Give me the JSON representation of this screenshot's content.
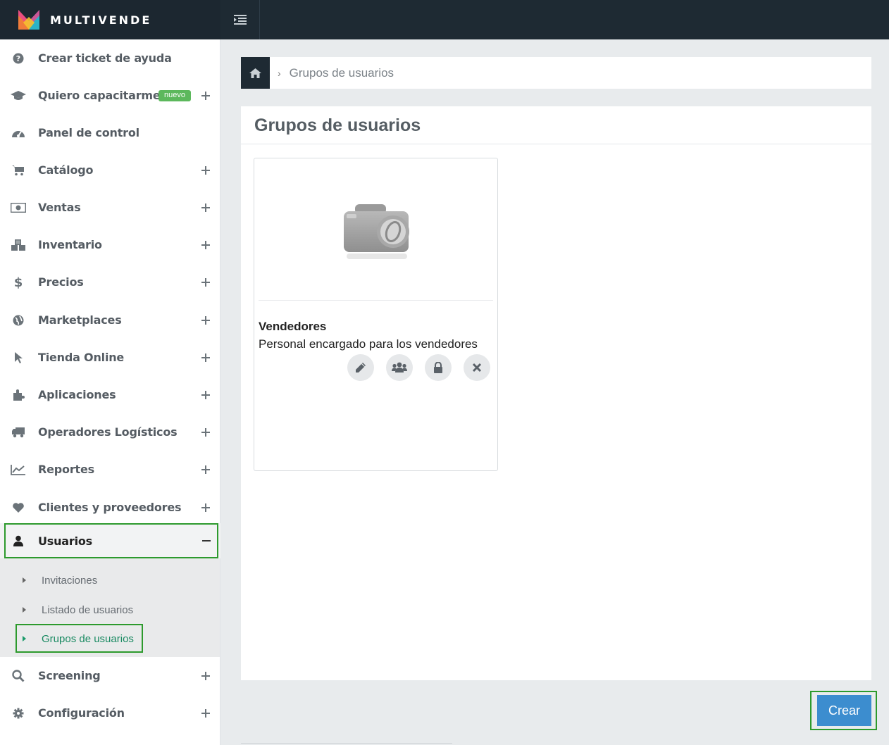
{
  "brand": {
    "name": "MULTIVENDE"
  },
  "breadcrumb": {
    "current": "Grupos de usuarios"
  },
  "sidebar": {
    "items": [
      {
        "label": "Crear ticket de ayuda",
        "icon": "question-circle-icon"
      },
      {
        "label": "Quiero capacitarme",
        "icon": "graduation-cap-icon",
        "badge": "nuevo"
      },
      {
        "label": "Panel de control",
        "icon": "dashboard-icon"
      },
      {
        "label": "Catálogo",
        "icon": "shopping-cart-icon"
      },
      {
        "label": "Ventas",
        "icon": "money-icon"
      },
      {
        "label": "Inventario",
        "icon": "cubes-icon"
      },
      {
        "label": "Precios",
        "icon": "dollar-icon"
      },
      {
        "label": "Marketplaces",
        "icon": "globe-icon"
      },
      {
        "label": "Tienda Online",
        "icon": "pointer-icon"
      },
      {
        "label": "Aplicaciones",
        "icon": "puzzle-icon"
      },
      {
        "label": "Operadores Logísticos",
        "icon": "truck-icon"
      },
      {
        "label": "Reportes",
        "icon": "line-chart-icon"
      },
      {
        "label": "Clientes y proveedores",
        "icon": "heart-icon"
      },
      {
        "label": "Usuarios",
        "icon": "user-icon"
      },
      {
        "label": "Screening",
        "icon": "search-icon"
      },
      {
        "label": "Configuración",
        "icon": "gear-icon"
      }
    ],
    "submenu": [
      {
        "label": "Invitaciones"
      },
      {
        "label": "Listado de usuarios"
      },
      {
        "label": "Grupos de usuarios"
      }
    ]
  },
  "panel": {
    "title": "Grupos de usuarios",
    "card": {
      "title": "Vendedores",
      "description": "Personal encargado para los vendedores"
    }
  },
  "actions": {
    "create_label": "Crear"
  },
  "colors": {
    "topbar": "#1e2a33",
    "accent_green": "#5cb85c",
    "button_blue": "#3c8dcf",
    "active_sub": "#1a8a62"
  }
}
